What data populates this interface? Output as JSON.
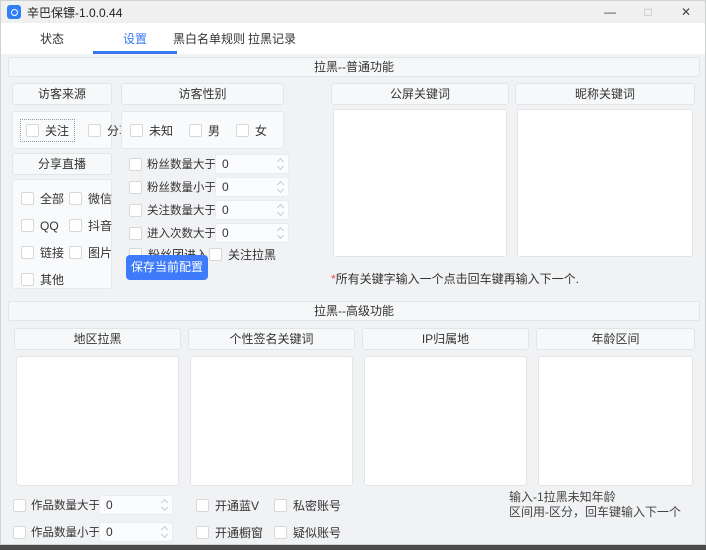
{
  "window": {
    "title": "辛巴保镖-1.0.0.44",
    "controls": {
      "minimize": "—",
      "maximize": "□",
      "close": "✕"
    }
  },
  "tabs": [
    {
      "label": "状态",
      "active": false
    },
    {
      "label": "设置",
      "active": true
    },
    {
      "label": "黑白名单规则",
      "active": false
    },
    {
      "label": "拉黑记录",
      "active": false
    }
  ],
  "colors": {
    "accent": "#3a78f2",
    "button": "#3e7bfa",
    "note_star": "#f14c4c"
  },
  "basic": {
    "section_title": "拉黑--普通功能",
    "visitor_source": {
      "title": "访客来源",
      "options": [
        "关注",
        "分享"
      ]
    },
    "share_live": {
      "title": "分享直播",
      "options": [
        "全部",
        "微信",
        "QQ",
        "抖音",
        "链接",
        "图片",
        "其他"
      ]
    },
    "visitor_gender": {
      "title": "访客性别",
      "options": [
        "未知",
        "男",
        "女"
      ]
    },
    "numeric_rules": [
      {
        "label": "粉丝数量大于",
        "value": "0"
      },
      {
        "label": "粉丝数量小于",
        "value": "0"
      },
      {
        "label": "关注数量大于",
        "value": "0"
      },
      {
        "label": "进入次数大于",
        "value": "0"
      }
    ],
    "extra_checks": [
      "粉丝团进入",
      "关注拉黑"
    ],
    "save_button": "保存当前配置",
    "public_keywords": {
      "title": "公屏关键词",
      "value": ""
    },
    "nickname_keywords": {
      "title": "昵称关键词",
      "value": ""
    },
    "note": {
      "star": "*",
      "text": "所有关键字输入一个点击回车键再输入下一个."
    }
  },
  "advanced": {
    "section_title": "拉黑--高级功能",
    "columns": [
      "地区拉黑",
      "个性签名关键词",
      "IP归属地",
      "年龄区间"
    ],
    "numeric_rules": [
      {
        "label": "作品数量大于",
        "value": "0"
      },
      {
        "label": "作品数量小于",
        "value": "0"
      }
    ],
    "toggles": {
      "blue_v": "开通蓝V",
      "shop_window": "开通橱窗",
      "private_account": "私密账号",
      "suspected_account": "疑似账号"
    },
    "age_note": {
      "line1": "输入-1拉黑未知年龄",
      "line2": "区间用-区分，回车键输入下一个"
    }
  }
}
